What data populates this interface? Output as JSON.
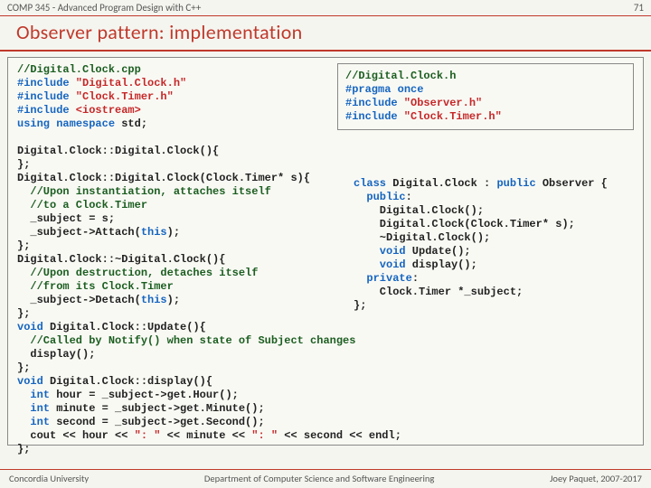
{
  "header": {
    "course": "COMP 345 - Advanced Program Design with C++",
    "page_number": "71"
  },
  "title": "Observer pattern: implementation",
  "left_code": {
    "l01": "//Digital.Clock.cpp",
    "l02a": "#include",
    "l02b": " \"Digital.Clock.h\"",
    "l03a": "#include",
    "l03b": " \"Clock.Timer.h\"",
    "l04a": "#include",
    "l04b": " <iostream>",
    "l05a": "using",
    "l05b": " ",
    "l05c": "namespace",
    "l05d": " std;",
    "gap1": "",
    "l06": "Digital.Clock::Digital.Clock(){",
    "l07": "};",
    "l08": "Digital.Clock::Digital.Clock(Clock.Timer* s){",
    "l09": "  //Upon instantiation, attaches itself",
    "l10": "  //to a Clock.Timer",
    "l11": "  _subject = s;",
    "l12a": "  _subject->Attach(",
    "l12b": "this",
    "l12c": ");",
    "l13": "};",
    "l14": "Digital.Clock::~Digital.Clock(){",
    "l15": "  //Upon destruction, detaches itself",
    "l16": "  //from its Clock.Timer",
    "l17a": "  _subject->Detach(",
    "l17b": "this",
    "l17c": ");",
    "l18": "};",
    "l19a": "void",
    "l19b": " Digital.Clock::Update(){",
    "l20": "  //Called by Notify() when state of Subject changes",
    "l21": "  display();",
    "l22": "};",
    "l23a": "void",
    "l23b": " Digital.Clock::display(){",
    "l24a": "  int",
    "l24b": " hour = _subject->get.Hour();",
    "l25a": "  int",
    "l25b": " minute = _subject->get.Minute();",
    "l26a": "  int",
    "l26b": " second = _subject->get.Second();",
    "l27a": "  cout << hour << ",
    "l27b": "\": \"",
    "l27c": " << minute << ",
    "l27d": "\": \"",
    "l27e": " << second << endl;",
    "l28": "};"
  },
  "right_header": {
    "r01": "//Digital.Clock.h",
    "r02a": "#pragma",
    "r02b": " ",
    "r02c": "once",
    "r03a": "#include",
    "r03b": " \"Observer.h\"",
    "r04a": "#include",
    "r04b": " \"Clock.Timer.h\""
  },
  "right_class": {
    "c01a": "class",
    "c01b": " Digital.Clock : ",
    "c01c": "public",
    "c01d": " Observer {",
    "c02a": "  public",
    "c02b": ":",
    "c03": "    Digital.Clock();",
    "c04": "    Digital.Clock(Clock.Timer* s);",
    "c05": "    ~Digital.Clock();",
    "c06a": "    void",
    "c06b": " Update();",
    "c07a": "    void",
    "c07b": " display();",
    "c08a": "  private",
    "c08b": ":",
    "c09": "    Clock.Timer *_subject;",
    "c10": "};"
  },
  "footer": {
    "left": "Concordia University",
    "center": "Department of Computer Science and Software Engineering",
    "right": "Joey Paquet, 2007-2017"
  }
}
